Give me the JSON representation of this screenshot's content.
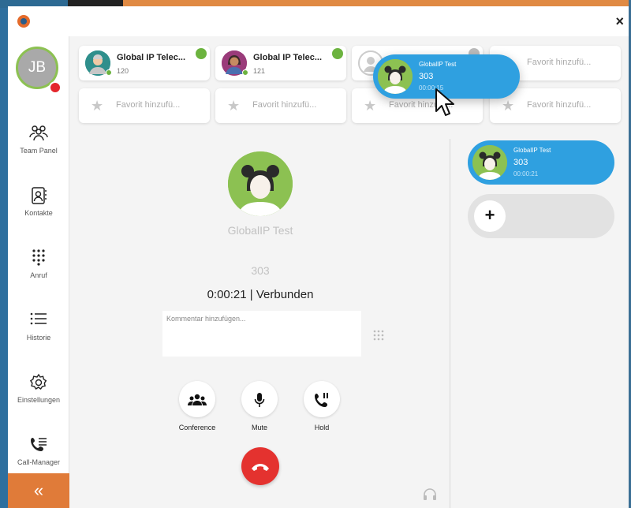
{
  "app": {
    "close_label": "×"
  },
  "user": {
    "initials": "JB"
  },
  "nav": [
    {
      "label": "Team Panel",
      "icon": "team-icon"
    },
    {
      "label": "Kontakte",
      "icon": "contacts-icon"
    },
    {
      "label": "Anruf",
      "icon": "dialpad-icon"
    },
    {
      "label": "Historie",
      "icon": "history-icon"
    },
    {
      "label": "Einstellungen",
      "icon": "gear-icon"
    },
    {
      "label": "Call-Manager",
      "icon": "call-manager-icon"
    }
  ],
  "collapse_label": "«",
  "favorites": [
    {
      "name": "Global IP Telec...",
      "ext": "120"
    },
    {
      "name": "Global IP Telec...",
      "ext": "121"
    }
  ],
  "favorite_add_label": "Favorit hinzufü...",
  "call": {
    "name": "GlobalIP Test",
    "number": "303",
    "status": "0:00:21 | Verbunden",
    "comment_placeholder": "Kommentar hinzufügen..."
  },
  "controls": {
    "conference": "Conference",
    "mute": "Mute",
    "hold": "Hold"
  },
  "active_call": {
    "name": "GlobalIP Test",
    "number": "303",
    "time": "00:00:21"
  },
  "drag_call": {
    "name": "GlobalIP Test",
    "number": "303",
    "time": "00:00:15"
  },
  "colors": {
    "accent_orange": "#e07b39",
    "presence_green": "#6cb33f",
    "call_blue": "#2fa0e0",
    "hangup_red": "#e4322f",
    "busy_red": "#e4262c"
  }
}
